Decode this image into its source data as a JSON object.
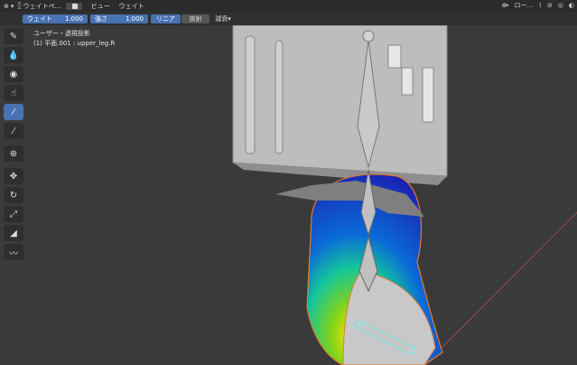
{
  "header": {
    "mode_label": "ウェイトペ…",
    "menu": [
      "ビュー",
      "ウェイト"
    ],
    "transform_orientation": "ロー…"
  },
  "tool_options": {
    "weight_label": "ウェイト",
    "weight_value": "1.000",
    "strength_label": "強さ",
    "strength_value": "1.000",
    "falloff_options": [
      "リニア",
      "放射"
    ],
    "blend_label": "減衰"
  },
  "viewport_overlay": {
    "view_name": "ユーザー・透視投影",
    "object_info": "(1) 平面.001 : upper_leg.R"
  },
  "toolbar": {
    "tools": [
      "draw-tool",
      "blur-tool",
      "average-tool",
      "smear-tool",
      "sample-weight-tool",
      "sample-group-tool",
      "cursor-tool",
      "move-tool",
      "rotate-tool",
      "scale-tool",
      "gradient-tool",
      "annotate-tool"
    ],
    "active": "sample-weight-tool"
  },
  "colors": {
    "accent": "#4772b3",
    "header_bg": "#2b2b2b",
    "viewport_bg": "#3a3a3a",
    "selection_outline": "#e8782a"
  }
}
